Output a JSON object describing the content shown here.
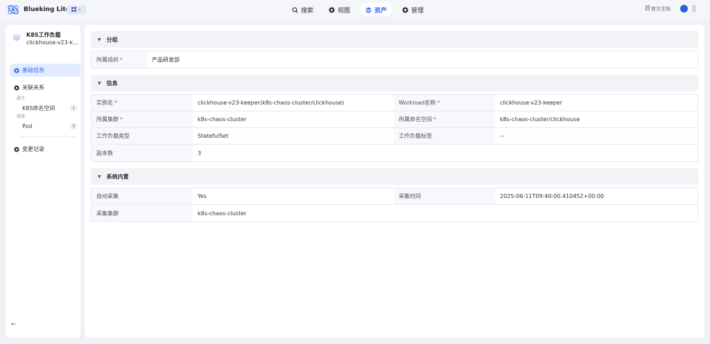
{
  "header": {
    "brand": "Blueking Lite",
    "switch_icon": "grid-icon",
    "nav": [
      {
        "label": "搜索",
        "icon": "search-icon",
        "active": false
      },
      {
        "label": "视图",
        "icon": "view-icon",
        "active": false
      },
      {
        "label": "资产",
        "icon": "layers-icon",
        "active": true
      },
      {
        "label": "管理",
        "icon": "manage-icon",
        "active": false
      }
    ],
    "doc_link": "官方文档"
  },
  "sidebar": {
    "title": "K8S工作负载",
    "subtitle": "clickhouse-v23-k...",
    "menu": [
      {
        "label": "基础信息",
        "active": true
      },
      {
        "label": "关联关系",
        "active": false
      }
    ],
    "groups": [
      {
        "label": "属于",
        "items": [
          {
            "label": "K8S命名空间",
            "count": "1"
          }
        ]
      },
      {
        "label": "组成",
        "items": [
          {
            "label": "Pod",
            "count": "3"
          }
        ]
      }
    ],
    "history": "变更记录",
    "collapse_icon": "arrow-left-icon"
  },
  "sections": {
    "group": {
      "title": "分组",
      "fields": [
        {
          "label": "所属组织",
          "required": true,
          "value": "产品研发部"
        }
      ]
    },
    "info": {
      "title": "信息",
      "rows": [
        [
          {
            "label": "实例名",
            "required": true,
            "value": "clickhouse-v23-keeper(k8s-chaos-cluster/clickhouse)"
          },
          {
            "label": "Workload名称",
            "required": true,
            "value": "clickhouse-v23-keeper"
          }
        ],
        [
          {
            "label": "所属集群",
            "required": true,
            "value": "k8s-chaos-cluster"
          },
          {
            "label": "所属命名空间",
            "required": true,
            "value": "k8s-chaos-cluster/clickhouse"
          }
        ],
        [
          {
            "label": "工作负载类型",
            "required": false,
            "value": "StatefulSet"
          },
          {
            "label": "工作负载标签",
            "required": false,
            "value": "--"
          }
        ],
        [
          {
            "label": "副本数",
            "required": false,
            "value": "3"
          }
        ]
      ]
    },
    "system": {
      "title": "系统内置",
      "rows": [
        [
          {
            "label": "自动采集",
            "value": "Yes"
          },
          {
            "label": "采集时间",
            "value": "2025-06-11T09:40:00.410452+00:00"
          }
        ],
        [
          {
            "label": "采集集群",
            "value": "k8s-chaos-cluster"
          }
        ]
      ]
    }
  },
  "required_mark": "*",
  "accent_color": "#3a6cf4",
  "required_color": "#e5484d"
}
